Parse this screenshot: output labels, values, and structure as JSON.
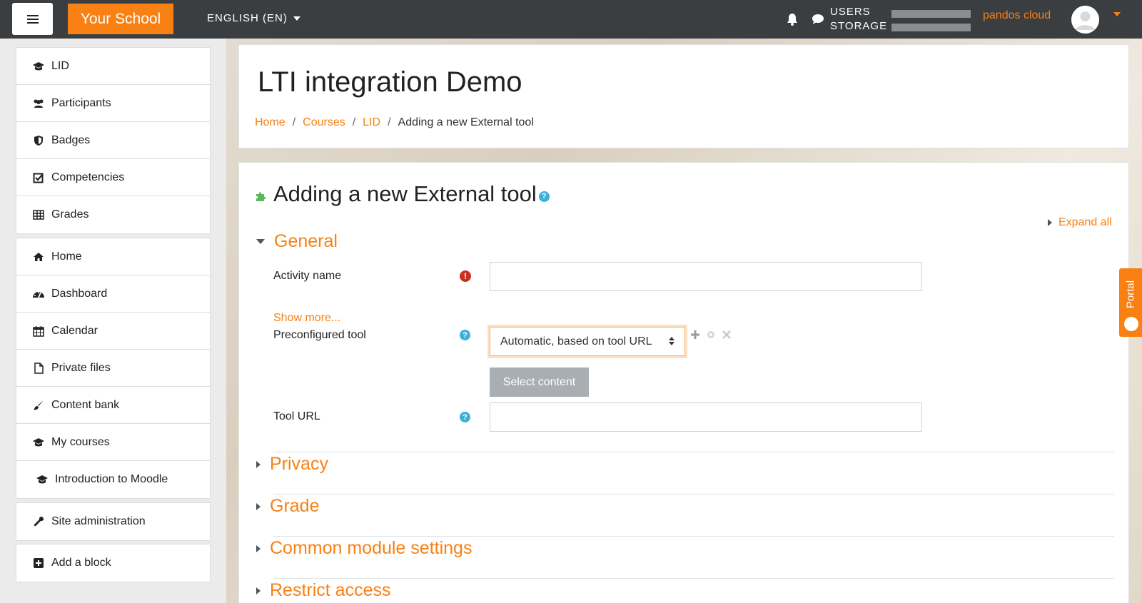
{
  "navbar": {
    "brand": "Your School",
    "language": "ENGLISH (EN)",
    "usage_labels": [
      "USERS",
      "STORAGE"
    ],
    "username": "pandos cloud",
    "usage": {
      "users": 0.0,
      "storage": 0.0
    }
  },
  "sidebar": {
    "group1": [
      {
        "label": "LID",
        "icon": "graduation-cap-icon"
      },
      {
        "label": "Participants",
        "icon": "users-icon"
      },
      {
        "label": "Badges",
        "icon": "shield-icon"
      },
      {
        "label": "Competencies",
        "icon": "check-square-icon"
      },
      {
        "label": "Grades",
        "icon": "table-icon"
      }
    ],
    "group2": [
      {
        "label": "Home",
        "icon": "home-icon"
      },
      {
        "label": "Dashboard",
        "icon": "dashboard-icon"
      },
      {
        "label": "Calendar",
        "icon": "calendar-icon"
      },
      {
        "label": "Private files",
        "icon": "file-icon"
      },
      {
        "label": "Content bank",
        "icon": "paint-brush-icon"
      },
      {
        "label": "My courses",
        "icon": "graduation-cap-icon"
      },
      {
        "label": "Introduction to Moodle",
        "icon": "graduation-cap-icon"
      }
    ],
    "group3": [
      {
        "label": "Site administration",
        "icon": "wrench-icon"
      }
    ],
    "group4": [
      {
        "label": "Add a block",
        "icon": "plus-square-icon"
      }
    ]
  },
  "header": {
    "title": "LTI integration Demo",
    "breadcrumb": [
      "Home",
      "Courses",
      "LID",
      "Adding a new External tool"
    ]
  },
  "form": {
    "title": "Adding a new External tool",
    "expand_all": "Expand all",
    "sections": {
      "general": "General",
      "privacy": "Privacy",
      "grade": "Grade",
      "common": "Common module settings",
      "restrict": "Restrict access"
    },
    "activity_name_label": "Activity name",
    "activity_name_value": "",
    "show_more": "Show more...",
    "preconfigured_label": "Preconfigured tool",
    "preconfigured_value": "Automatic, based on tool URL",
    "select_content": "Select content",
    "tool_url_label": "Tool URL",
    "tool_url_value": ""
  },
  "portal_tab": "Portal",
  "colors": {
    "accent": "#f98012",
    "navbar": "#3b3e40",
    "help": "#3bb0d8",
    "required": "#ca3120"
  }
}
